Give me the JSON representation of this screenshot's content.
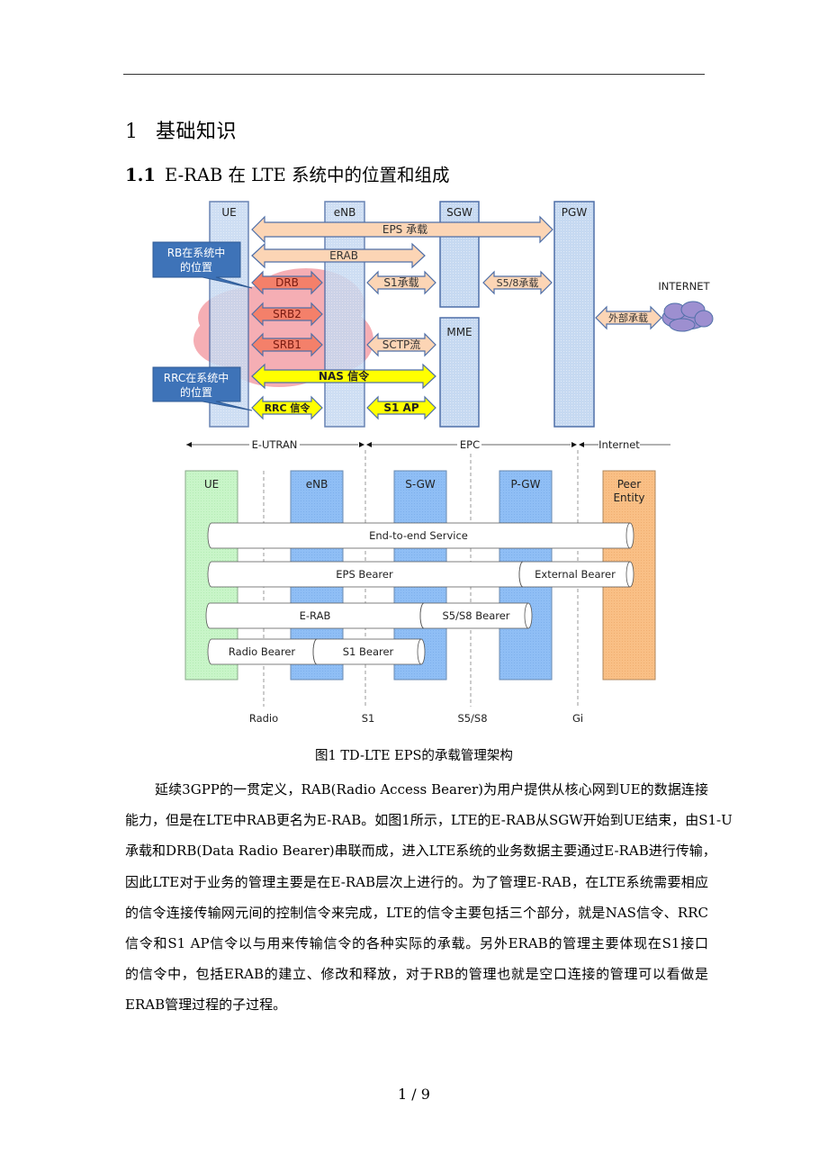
{
  "heading1": {
    "number": "1",
    "title": "基础知识"
  },
  "heading2": {
    "number": "1.1",
    "title": "E-RAB 在 LTE 系统中的位置和组成"
  },
  "figure1_top": {
    "nodes": {
      "ue": "UE",
      "enb": "eNB",
      "sgw": "SGW",
      "mme": "MME",
      "pgw": "PGW",
      "internet": "INTERNET"
    },
    "arrows": {
      "eps": "EPS 承载",
      "erab": "ERAB",
      "drb": "DRB",
      "srb2": "SRB2",
      "srb1": "SRB1",
      "s1_bearer": "S1承载",
      "s58_bearer": "S5/8承载",
      "sctp": "SCTP流",
      "nas": "NAS 信令",
      "rrc": "RRC 信令",
      "s1ap": "S1 AP",
      "external": "外部承载"
    },
    "callouts": {
      "rb_line1": "RB在系统中",
      "rb_line2": "的位置",
      "rrc_line1": "RRC在系统中",
      "rrc_line2": "的位置"
    },
    "colors": {
      "node_fill": "#c6d9f1",
      "node_border": "#4f6fa8",
      "peach": "#fcd5b5",
      "red_arrow": "#f4806a",
      "yellow": "#ffff00",
      "callout": "#3e73b8",
      "cloud_pink": "#f4a0a8",
      "cloud_purple": "#9d8fd0"
    }
  },
  "figure1_bottom": {
    "domains": {
      "eutran": "E-UTRAN",
      "epc": "EPC",
      "internet": "Internet"
    },
    "nodes": {
      "ue": "UE",
      "enb": "eNB",
      "sgw": "S-GW",
      "pgw": "P-GW",
      "peer1": "Peer",
      "peer2": "Entity"
    },
    "bearers": {
      "e2e": "End-to-end Service",
      "eps": "EPS Bearer",
      "external": "External Bearer",
      "erab": "E-RAB",
      "s5s8": "S5/S8 Bearer",
      "radio": "Radio Bearer",
      "s1": "S1 Bearer"
    },
    "interfaces": {
      "radio": "Radio",
      "s1": "S1",
      "s5s8": "S5/S8",
      "gi": "Gi"
    },
    "colors": {
      "ue": "#c8f5c8",
      "core": "#8fbef5",
      "peer": "#f9bf85"
    }
  },
  "caption": "图1 TD-LTE EPS的承载管理架构",
  "paragraph": [
    "延续3GPP的一贯定义，RAB(Radio Access Bearer)为用户提供从核心网到UE的数据连接",
    "能力，但是在LTE中RAB更名为E-RAB。如图1所示，LTE的E-RAB从SGW开始到UE结束，由S1-U",
    "承载和DRB(Data Radio Bearer)串联而成，进入LTE系统的业务数据主要通过E-RAB进行传输，",
    "因此LTE对于业务的管理主要是在E-RAB层次上进行的。为了管理E-RAB，在LTE系统需要相应",
    "的信令连接传输网元间的控制信令来完成，LTE的信令主要包括三个部分，就是NAS信令、RRC",
    "信令和S1 AP信令以与用来传输信令的各种实际的承载。另外ERAB的管理主要体现在S1接口",
    "的信令中，包括ERAB的建立、修改和释放，对于RB的管理也就是空口连接的管理可以看做是",
    "ERAB管理过程的子过程。"
  ],
  "page_number": "1 / 9"
}
